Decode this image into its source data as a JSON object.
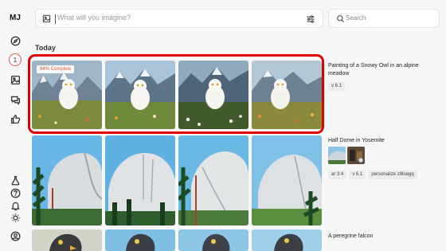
{
  "app": {
    "logo": "MJ"
  },
  "sidebar": {
    "notification_count": "1",
    "icons": [
      "compass-icon",
      "notification-badge",
      "image-icon",
      "chat-icon",
      "thumbs-up-icon",
      "lab-flask-icon",
      "help-icon",
      "bell-icon",
      "sun-icon",
      "profile-icon"
    ]
  },
  "prompt_bar": {
    "placeholder": "What will you imagine?"
  },
  "search": {
    "placeholder": "Search"
  },
  "feed": {
    "section_title": "Today",
    "jobs": [
      {
        "prompt": "Painting of a Snowy Owl in an alpine meadow",
        "params": [
          "v 6.1"
        ],
        "progress": "94% Complete",
        "subject": "snowy-owl"
      },
      {
        "prompt": "Half Dome in Yosemite",
        "params": [
          "ar 3:4",
          "v 6.1",
          "personalize z8luegq"
        ],
        "subject": "half-dome"
      },
      {
        "prompt": "A peregrine falcon",
        "params": [],
        "subject": "falcon"
      }
    ]
  },
  "colors": {
    "highlight": "#e10000",
    "progress_text": "#e05a3a",
    "background": "#f7f7f8"
  }
}
